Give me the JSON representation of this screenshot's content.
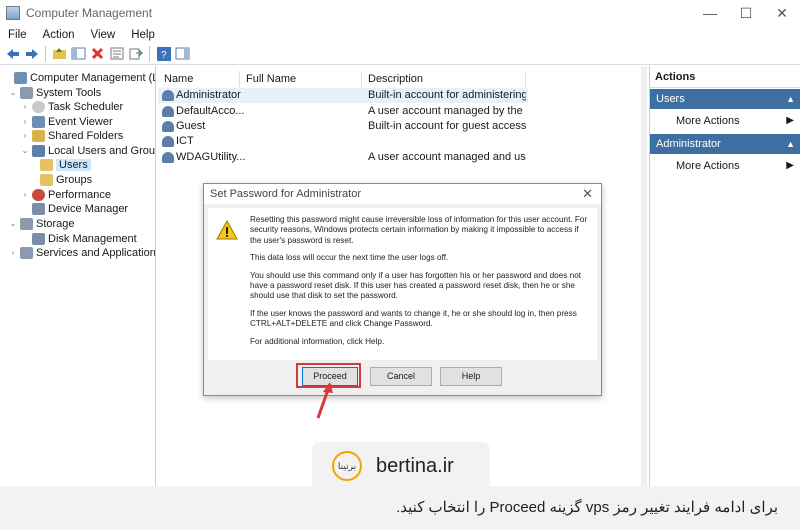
{
  "window": {
    "title": "Computer Management",
    "minimize": "—",
    "maximize": "☐",
    "close": "✕"
  },
  "menu": [
    "File",
    "Action",
    "View",
    "Help"
  ],
  "tree": [
    {
      "label": "Computer Management (Local)",
      "arrow": "",
      "icon_color": "#6c8fb5"
    },
    {
      "label": "System Tools",
      "arrow": "⌄",
      "icon_color": "#8a9bb0"
    },
    {
      "label": "Task Scheduler",
      "arrow": "›",
      "icon_color": "#c9c9c9"
    },
    {
      "label": "Event Viewer",
      "arrow": "›",
      "icon_color": "#6c8fb5"
    },
    {
      "label": "Shared Folders",
      "arrow": "›",
      "icon_color": "#d9b34a"
    },
    {
      "label": "Local Users and Groups",
      "arrow": "⌄",
      "icon_color": "#5b7fa9"
    },
    {
      "label": "Users",
      "arrow": "",
      "icon_color": "#e8c160"
    },
    {
      "label": "Groups",
      "arrow": "",
      "icon_color": "#e8c160"
    },
    {
      "label": "Performance",
      "arrow": "›",
      "icon_color": "#c84b3c"
    },
    {
      "label": "Device Manager",
      "arrow": "",
      "icon_color": "#7a8fa5"
    },
    {
      "label": "Storage",
      "arrow": "⌄",
      "icon_color": "#8a9bb0"
    },
    {
      "label": "Disk Management",
      "arrow": "",
      "icon_color": "#7a8fa5"
    },
    {
      "label": "Services and Applications",
      "arrow": "›",
      "icon_color": "#8a9bb0"
    }
  ],
  "columns": {
    "name": "Name",
    "full_name": "Full Name",
    "description": "Description"
  },
  "users": [
    {
      "name": "Administrator",
      "description": "Built-in account for administering ..."
    },
    {
      "name": "DefaultAcco...",
      "description": "A user account managed by the sy..."
    },
    {
      "name": "Guest",
      "description": "Built-in account for guest access t..."
    },
    {
      "name": "ICT",
      "description": ""
    },
    {
      "name": "WDAGUtility...",
      "description": "A user account managed and used..."
    }
  ],
  "actions": {
    "title": "Actions",
    "sections": [
      {
        "label": "Users",
        "link": "More Actions"
      },
      {
        "label": "Administrator",
        "link": "More Actions"
      }
    ]
  },
  "dialog": {
    "title": "Set Password for Administrator",
    "paragraphs": [
      "Resetting this password might cause irreversible loss of information for this user account. For security reasons, Windows protects certain information by making it impossible to access if the user's password is reset.",
      "This data loss will occur the next time the user logs off.",
      "You should use this command only if a user has forgotten his or her password and does not have a password reset disk. If this user has created a password reset disk, then he or she should use that disk to set the password.",
      "If the user knows the password and wants to change it, he or she should log in, then press CTRL+ALT+DELETE and click Change Password.",
      "For additional information, click Help."
    ],
    "buttons": {
      "proceed": "Proceed",
      "cancel": "Cancel",
      "help": "Help"
    }
  },
  "watermark": {
    "brand": "bertina.ir",
    "mark": "برتینا"
  },
  "caption": "برای ادامه فرایند تغییر رمز vps گزینه Proceed را انتخاب کنید.",
  "colors": {
    "accent": "#3f6fa0",
    "highlight": "#d63a3a",
    "selection": "#cce8ff"
  }
}
